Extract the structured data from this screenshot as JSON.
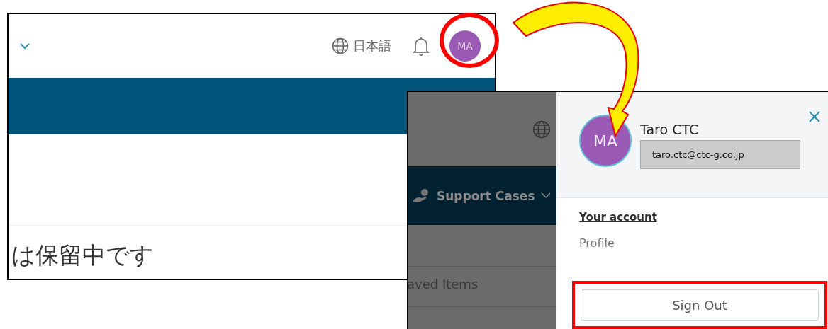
{
  "before": {
    "language": "日本語",
    "avatar": "MA",
    "heading": "は保留中です"
  },
  "after": {
    "nav_item": "Support Cases",
    "list_item": "aved Items",
    "account_panel": {
      "avatar": "MA",
      "name": "Taro CTC",
      "email": "taro.ctc@ctc-g.co.jp",
      "links": [
        "Your account",
        "Profile"
      ],
      "sign_out": "Sign Out"
    }
  }
}
